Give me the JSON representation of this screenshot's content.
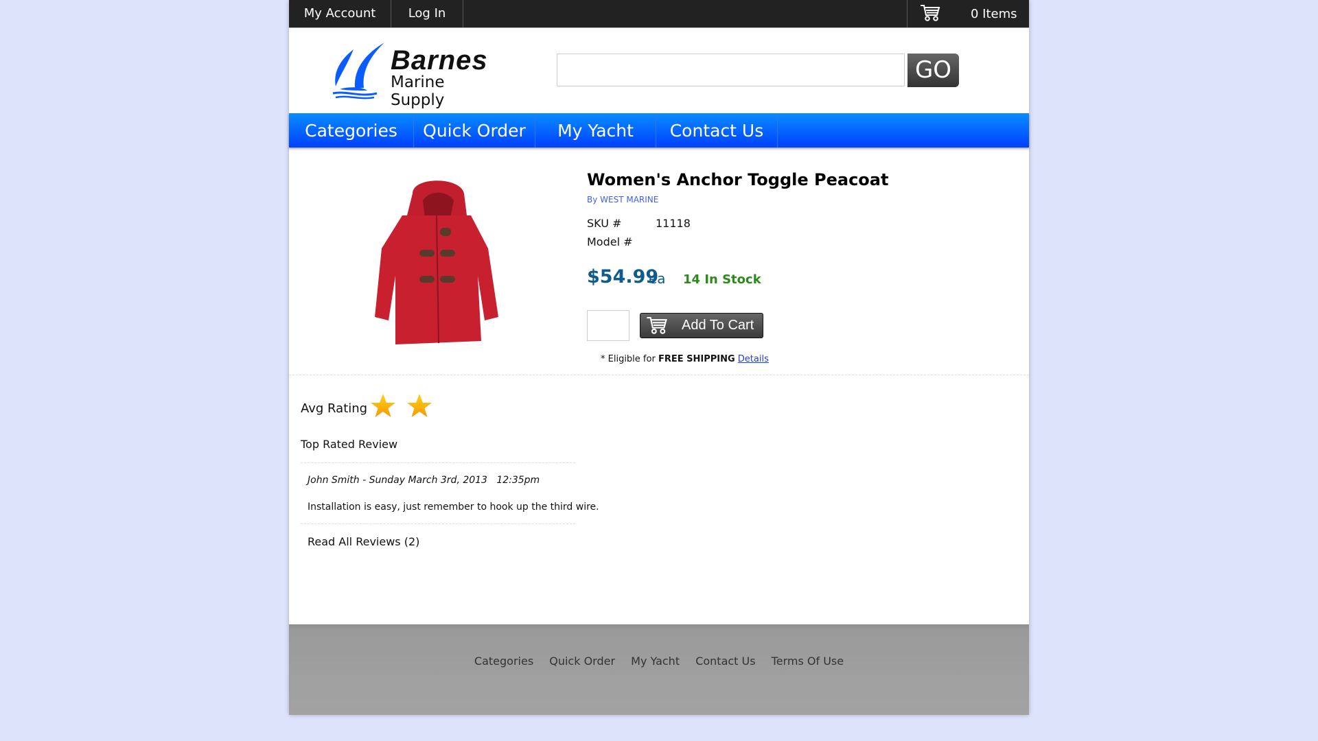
{
  "topbar": {
    "my_account": "My Account",
    "log_in": "Log In",
    "cart_icon": "cart-icon",
    "cart_count": "0 Items"
  },
  "header": {
    "logo_line1": "Barnes",
    "logo_line2": "Marine Supply",
    "search_value": "",
    "search_placeholder": "",
    "go_label": "GO"
  },
  "nav": {
    "items": [
      {
        "label": "Categories"
      },
      {
        "label": "Quick Order"
      },
      {
        "label": "My Yacht"
      },
      {
        "label": "Contact Us"
      }
    ]
  },
  "product": {
    "title": "Women's Anchor Toggle Peacoat",
    "brand": "By WEST MARINE",
    "sku_label": "SKU #",
    "sku_value": "11118",
    "model_label": "Model #",
    "model_value": "",
    "price": "$54.99",
    "unit": "ea",
    "stock": "14 In Stock",
    "quantity_value": "",
    "add_to_cart_label": "Add To Cart",
    "shipping_prefix": "* Eligible for",
    "shipping_bold": "FREE SHIPPING",
    "shipping_link": "Details",
    "image_alt": "red hooded toggle peacoat",
    "colors": {
      "price": "#0f5b8c",
      "stock": "#2b8a1a",
      "brand": "#3d5ff0"
    }
  },
  "reviews": {
    "avg_label": "Avg Rating",
    "avg_rating_stars": 2,
    "top_rated_label": "Top Rated Review",
    "author_line": "John Smith - Sunday March 3rd, 2013   12:35pm",
    "text": "Installation is easy, just remember to hook up the third wire.",
    "read_all": "Read All Reviews (2)"
  },
  "footer": {
    "links": [
      {
        "label": "Categories"
      },
      {
        "label": "Quick Order"
      },
      {
        "label": "My Yacht"
      },
      {
        "label": "Contact Us"
      },
      {
        "label": "Terms Of Use"
      }
    ]
  },
  "theme": {
    "nav_blue": "#0a6cff",
    "topbar": "#222222",
    "page_bg": "#dde3fb"
  }
}
